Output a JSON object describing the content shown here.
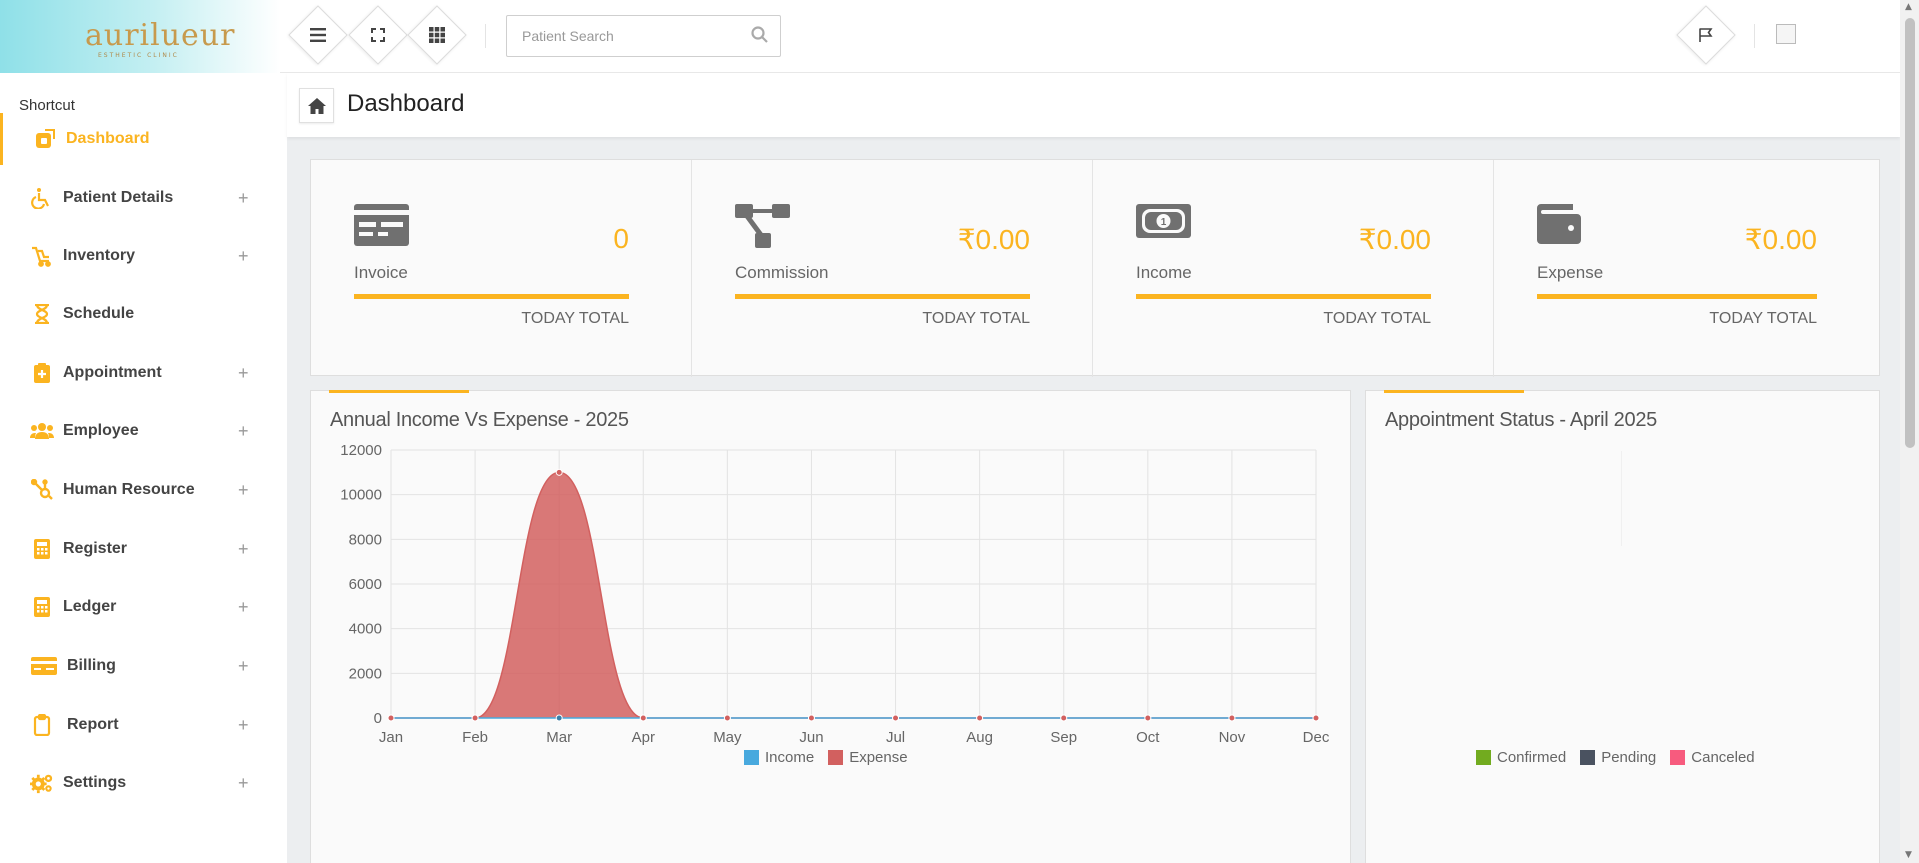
{
  "brand": {
    "logo_text": "aurilueur",
    "logo_sub": "ESTHETIC CLINIC"
  },
  "header": {
    "search_placeholder": "Patient Search",
    "icons": [
      "menu-icon",
      "fullscreen-icon",
      "apps-grid-icon",
      "search-icon",
      "flag-icon"
    ]
  },
  "sidebar": {
    "heading": "Shortcut",
    "items": [
      {
        "label": "Dashboard",
        "icon": "dashboard-icon",
        "expandable": false,
        "active": true
      },
      {
        "label": "Patient Details",
        "icon": "wheelchair-icon",
        "expandable": true
      },
      {
        "label": "Inventory",
        "icon": "cart-icon",
        "expandable": true
      },
      {
        "label": "Schedule",
        "icon": "hourglass-icon",
        "expandable": false
      },
      {
        "label": "Appointment",
        "icon": "clipboard-plus-icon",
        "expandable": true
      },
      {
        "label": "Employee",
        "icon": "users-icon",
        "expandable": true
      },
      {
        "label": "Human Resource",
        "icon": "hubspot-icon",
        "expandable": true
      },
      {
        "label": "Register",
        "icon": "calculator-icon",
        "expandable": true
      },
      {
        "label": "Ledger",
        "icon": "calculator-icon",
        "expandable": true
      },
      {
        "label": "Billing",
        "icon": "credit-card-icon",
        "expandable": true
      },
      {
        "label": "Report",
        "icon": "clipboard-icon",
        "expandable": true
      },
      {
        "label": "Settings",
        "icon": "cogs-icon",
        "expandable": true
      }
    ],
    "plus_symbol": "+"
  },
  "page": {
    "title": "Dashboard"
  },
  "stats": [
    {
      "label": "Invoice",
      "value": "0",
      "footer": "TODAY TOTAL",
      "icon": "invoice-card-icon"
    },
    {
      "label": "Commission",
      "value": "₹0.00",
      "footer": "TODAY TOTAL",
      "icon": "sitemap-icon"
    },
    {
      "label": "Income",
      "value": "₹0.00",
      "footer": "TODAY TOTAL",
      "icon": "money-bill-icon"
    },
    {
      "label": "Expense",
      "value": "₹0.00",
      "footer": "TODAY TOTAL",
      "icon": "wallet-icon"
    }
  ],
  "income_panel": {
    "title": "Annual Income Vs Expense - 2025"
  },
  "status_panel": {
    "title": "Appointment Status - April 2025",
    "legend": [
      {
        "name": "Confirmed",
        "color": "#72ab1f"
      },
      {
        "name": "Pending",
        "color": "#4a5260"
      },
      {
        "name": "Canceled",
        "color": "#f75b7e"
      }
    ]
  },
  "colors": {
    "accent": "#fbb420",
    "income": "#48a9de",
    "expense": "#d2605f"
  },
  "chart_data": {
    "type": "area",
    "title": "Annual Income Vs Expense - 2025",
    "categories": [
      "Jan",
      "Feb",
      "Mar",
      "Apr",
      "May",
      "Jun",
      "Jul",
      "Aug",
      "Sep",
      "Oct",
      "Nov",
      "Dec"
    ],
    "series": [
      {
        "name": "Income",
        "values": [
          0,
          0,
          0,
          0,
          0,
          0,
          0,
          0,
          0,
          0,
          0,
          0
        ],
        "color": "#48a9de"
      },
      {
        "name": "Expense",
        "values": [
          0,
          0,
          11000,
          0,
          0,
          0,
          0,
          0,
          0,
          0,
          0,
          0
        ],
        "color": "#d2605f"
      }
    ],
    "ylim": [
      0,
      12000
    ],
    "yticks": [
      0,
      2000,
      4000,
      6000,
      8000,
      10000,
      12000
    ],
    "grid": true,
    "legend": "bottom"
  }
}
